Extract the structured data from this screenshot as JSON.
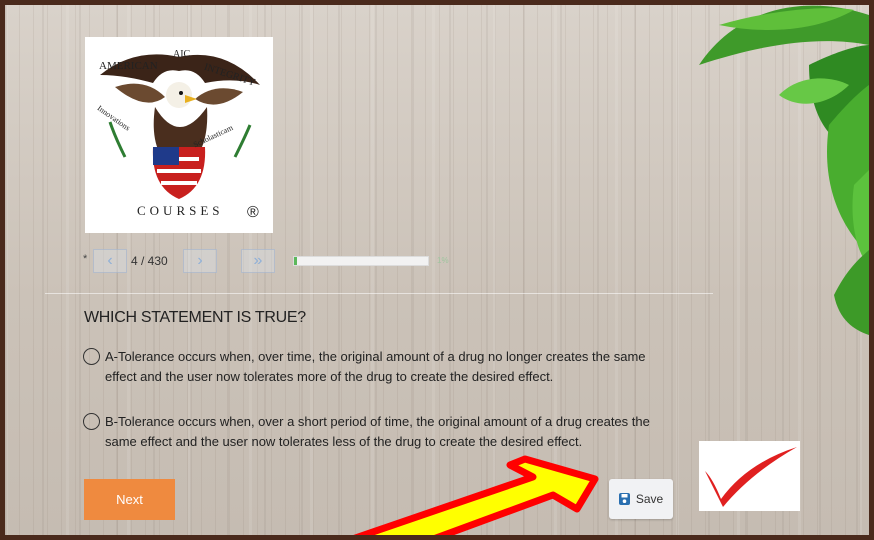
{
  "logo": {
    "top_left_text": "AMERICAN",
    "top_center_text": "AIC",
    "top_right_text": "INTEGRITY",
    "left_band_text": "Innovations",
    "right_band_text": "Scholasticam",
    "bottom_text": "COURSES",
    "registered_mark": "®"
  },
  "pager": {
    "star": "*",
    "prev_icon": "chevron-left-icon",
    "count": "4 / 430",
    "next_icon": "chevron-right-icon",
    "last_icon": "double-chevron-right-icon",
    "progress": 0.01,
    "percent_label": "1%"
  },
  "question": {
    "title": "WHICH STATEMENT IS TRUE?",
    "options": [
      {
        "text": "A-Tolerance occurs when, over time, the original amount of a drug no longer creates the same effect and the user now tolerates more of the drug to create the desired effect."
      },
      {
        "text": "B-Tolerance occurs when, over a short period of time, the original amount of a drug creates the same effect and the user now tolerates less of the drug to create the desired effect."
      }
    ]
  },
  "actions": {
    "next_label": "Next",
    "save_label": "Save",
    "save_icon": "disk-icon"
  },
  "colors": {
    "next_button": "#ef8a3f",
    "arrow_fill": "#ffff00",
    "arrow_outline": "#ff0000",
    "checkmark": "#e02020",
    "progress_fill": "#5cb85c",
    "frame": "#4a2a1c"
  }
}
